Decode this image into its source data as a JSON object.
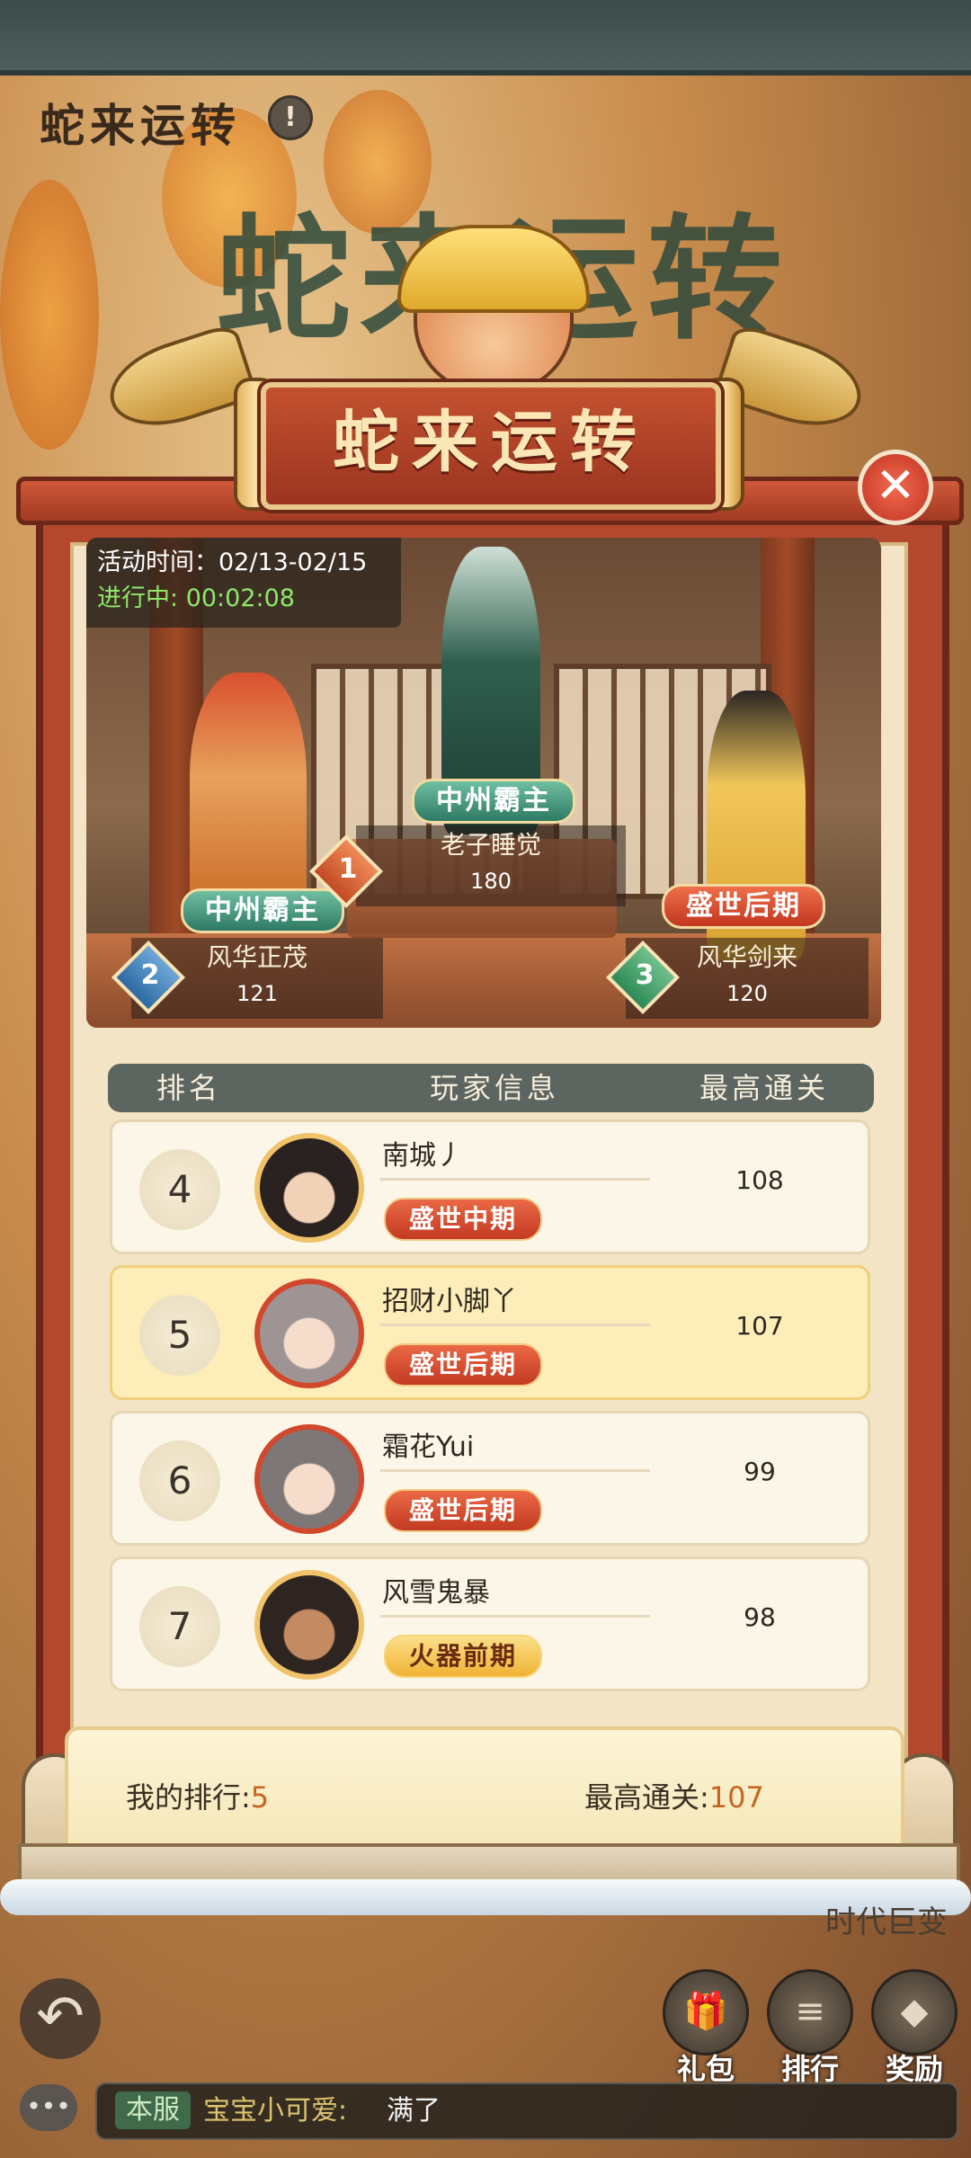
{
  "header": {
    "title": "蛇来运转",
    "info_icon": "info-icon"
  },
  "banner": {
    "title": "蛇来运转",
    "big_title": "蛇来运转"
  },
  "event": {
    "time_label": "活动时间：",
    "time_range": "02/13-02/15",
    "status_label": "进行中:",
    "countdown": "00:02:08"
  },
  "podium": {
    "first": {
      "rank": "1",
      "name": "老子睡觉",
      "score": "180",
      "title": "中州霸主"
    },
    "second": {
      "rank": "2",
      "name": "风华正茂",
      "score": "121",
      "title": "中州霸主"
    },
    "third": {
      "rank": "3",
      "name": "风华剑来",
      "score": "120",
      "title": "盛世后期"
    }
  },
  "table": {
    "headers": [
      "排名",
      "玩家信息",
      "最高通关"
    ],
    "rows": [
      {
        "rank": "4",
        "name": "南城丿",
        "title": "盛世中期",
        "score": "108"
      },
      {
        "rank": "5",
        "name": "招财小脚丫",
        "title": "盛世后期",
        "score": "107"
      },
      {
        "rank": "6",
        "name": "霜花Yui",
        "title": "盛世后期",
        "score": "99"
      },
      {
        "rank": "7",
        "name": "风雪鬼暴",
        "title": "火器前期",
        "score": "98"
      }
    ]
  },
  "footer": {
    "my_rank_label": "我的排行:",
    "my_rank": "5",
    "best_label": "最高通关:",
    "best": "107"
  },
  "side_menu": {
    "label": "时代巨变",
    "buttons": [
      {
        "label": "礼包",
        "icon": "gift-icon"
      },
      {
        "label": "排行",
        "icon": "ranking-icon"
      },
      {
        "label": "奖励",
        "icon": "reward-icon"
      }
    ]
  },
  "chat": {
    "channel": "本服",
    "sender": "宝宝小可爱:",
    "message": "满了"
  },
  "colors": {
    "accent_red": "#b3482e",
    "countdown_green": "#8ee86a",
    "highlight_orange": "#c6651f"
  }
}
